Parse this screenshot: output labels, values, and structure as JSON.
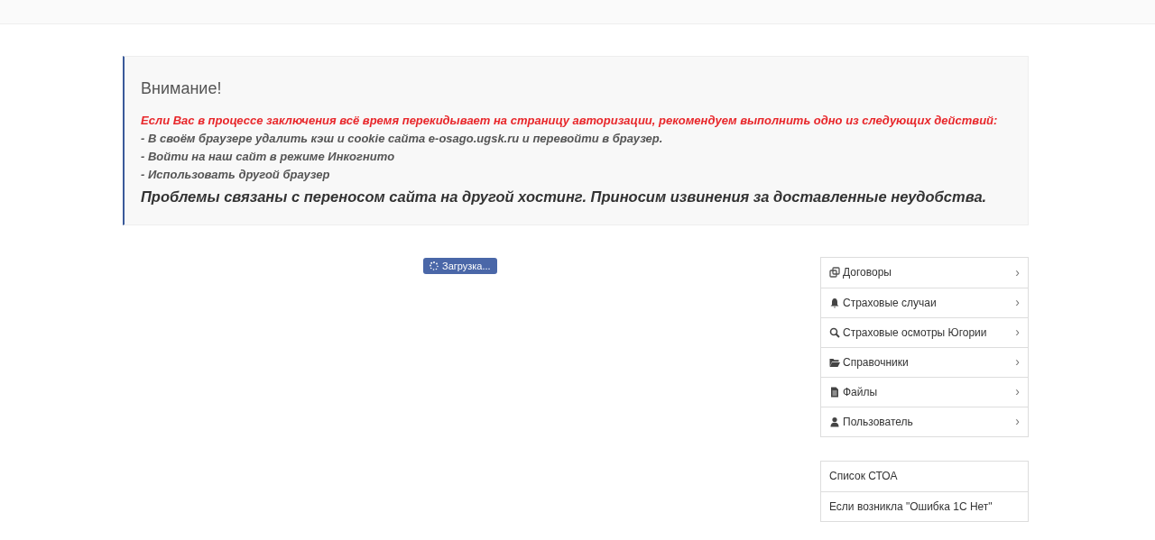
{
  "alert": {
    "title": "Внимание!",
    "warning": "Если Вас в процессе заключения всё время перекидывает на страницу авторизации, рекомендуем выполнить одно из следующих действий:",
    "steps": [
      "- В своём браузере удалить кэш и cookie сайта e-osago.ugsk.ru и перевойти в браузер.",
      "- Войти на наш сайт в режиме Инкогнито",
      "- Использовать другой браузер"
    ],
    "note": "Проблемы связаны с переносом сайта на другой хостинг. Приносим извинения за доставленные неудобства."
  },
  "loading": {
    "label": "Загрузка..."
  },
  "menu": [
    {
      "kind": "copy",
      "label": "Договоры",
      "chevron": "›"
    },
    {
      "kind": "bell",
      "label": "Страховые случаи",
      "chevron": "›"
    },
    {
      "kind": "search",
      "label": "Страховые осмотры Югории",
      "chevron": "›"
    },
    {
      "kind": "folder",
      "label": "Справочники",
      "chevron": "›"
    },
    {
      "kind": "file",
      "label": "Файлы",
      "chevron": "›"
    },
    {
      "kind": "user",
      "label": "Пользователь",
      "chevron": "›"
    }
  ],
  "links": [
    "Список СТОА",
    "Если возникла \"Ошибка 1С Нет\""
  ]
}
